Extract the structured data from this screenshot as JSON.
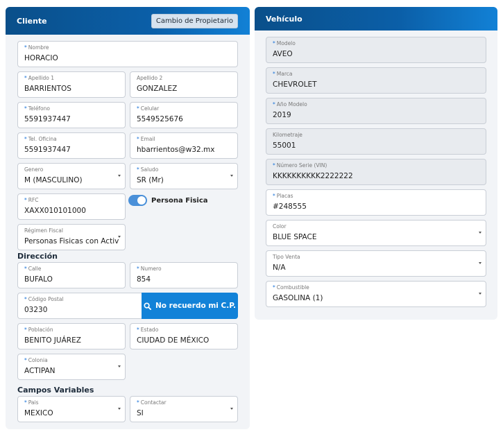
{
  "cliente": {
    "title": "Cliente",
    "owner_change_label": "Cambio de Propietario",
    "nombre": {
      "label": "Nombre",
      "value": "HORACIO"
    },
    "apellido1": {
      "label": "Apellido 1",
      "value": "BARRIENTOS"
    },
    "apellido2": {
      "label": "Apellido 2",
      "value": "GONZALEZ"
    },
    "telefono": {
      "label": "Teléfono",
      "value": "5591937447"
    },
    "celular": {
      "label": "Celular",
      "value": "5549525676"
    },
    "tel_oficina": {
      "label": "Tel. Oficina",
      "value": "5591937447"
    },
    "email": {
      "label": "Email",
      "value": "hbarrientos@w32.mx"
    },
    "genero": {
      "label": "Genero",
      "value": "M (MASCULINO)"
    },
    "saludo": {
      "label": "Saludo",
      "value": "SR (Mr)"
    },
    "rfc": {
      "label": "RFC",
      "value": "XAXX010101000"
    },
    "persona_fisica_label": "Persona Fisica",
    "regimen": {
      "label": "Régimen Fiscal",
      "value": "Personas Fisicas con Activ"
    }
  },
  "direccion": {
    "title": "Dirección",
    "calle": {
      "label": "Calle",
      "value": "BUFALO"
    },
    "numero": {
      "label": "Numero",
      "value": "854"
    },
    "cp": {
      "label": "Código Postal",
      "value": "03230"
    },
    "cp_button_label": "No recuerdo mi C.P.",
    "poblacion": {
      "label": "Población",
      "value": "BENITO JUÁREZ"
    },
    "estado": {
      "label": "Estado",
      "value": "CIUDAD DE MÉXICO"
    },
    "colonia": {
      "label": "Colonia",
      "value": "ACTIPAN"
    }
  },
  "campos_variables": {
    "title": "Campos Variables",
    "pais": {
      "label": "Pais",
      "value": "MEXICO"
    },
    "contactar": {
      "label": "Contactar",
      "value": "SI"
    }
  },
  "vehiculo": {
    "title": "Vehículo",
    "modelo": {
      "label": "Modelo",
      "value": "AVEO"
    },
    "marca": {
      "label": "Marca",
      "value": "CHEVROLET"
    },
    "anio": {
      "label": "Año Modelo",
      "value": "2019"
    },
    "kilometraje": {
      "label": "Kilometraje",
      "value": "55001"
    },
    "vin": {
      "label": "Número Serie (VIN)",
      "value": "KKKKKKKKKK2222222"
    },
    "placas": {
      "label": "Placas",
      "value": "#248555"
    },
    "color": {
      "label": "Color",
      "value": "BLUE SPACE"
    },
    "tipo_venta": {
      "label": "Tipo Venta",
      "value": "N/A"
    },
    "combustible": {
      "label": "Combustible",
      "value": "GASOLINA (1)"
    }
  },
  "colors": {
    "header": "#0b5fa8",
    "accent": "#1282d8",
    "required": "#1a73d9"
  }
}
